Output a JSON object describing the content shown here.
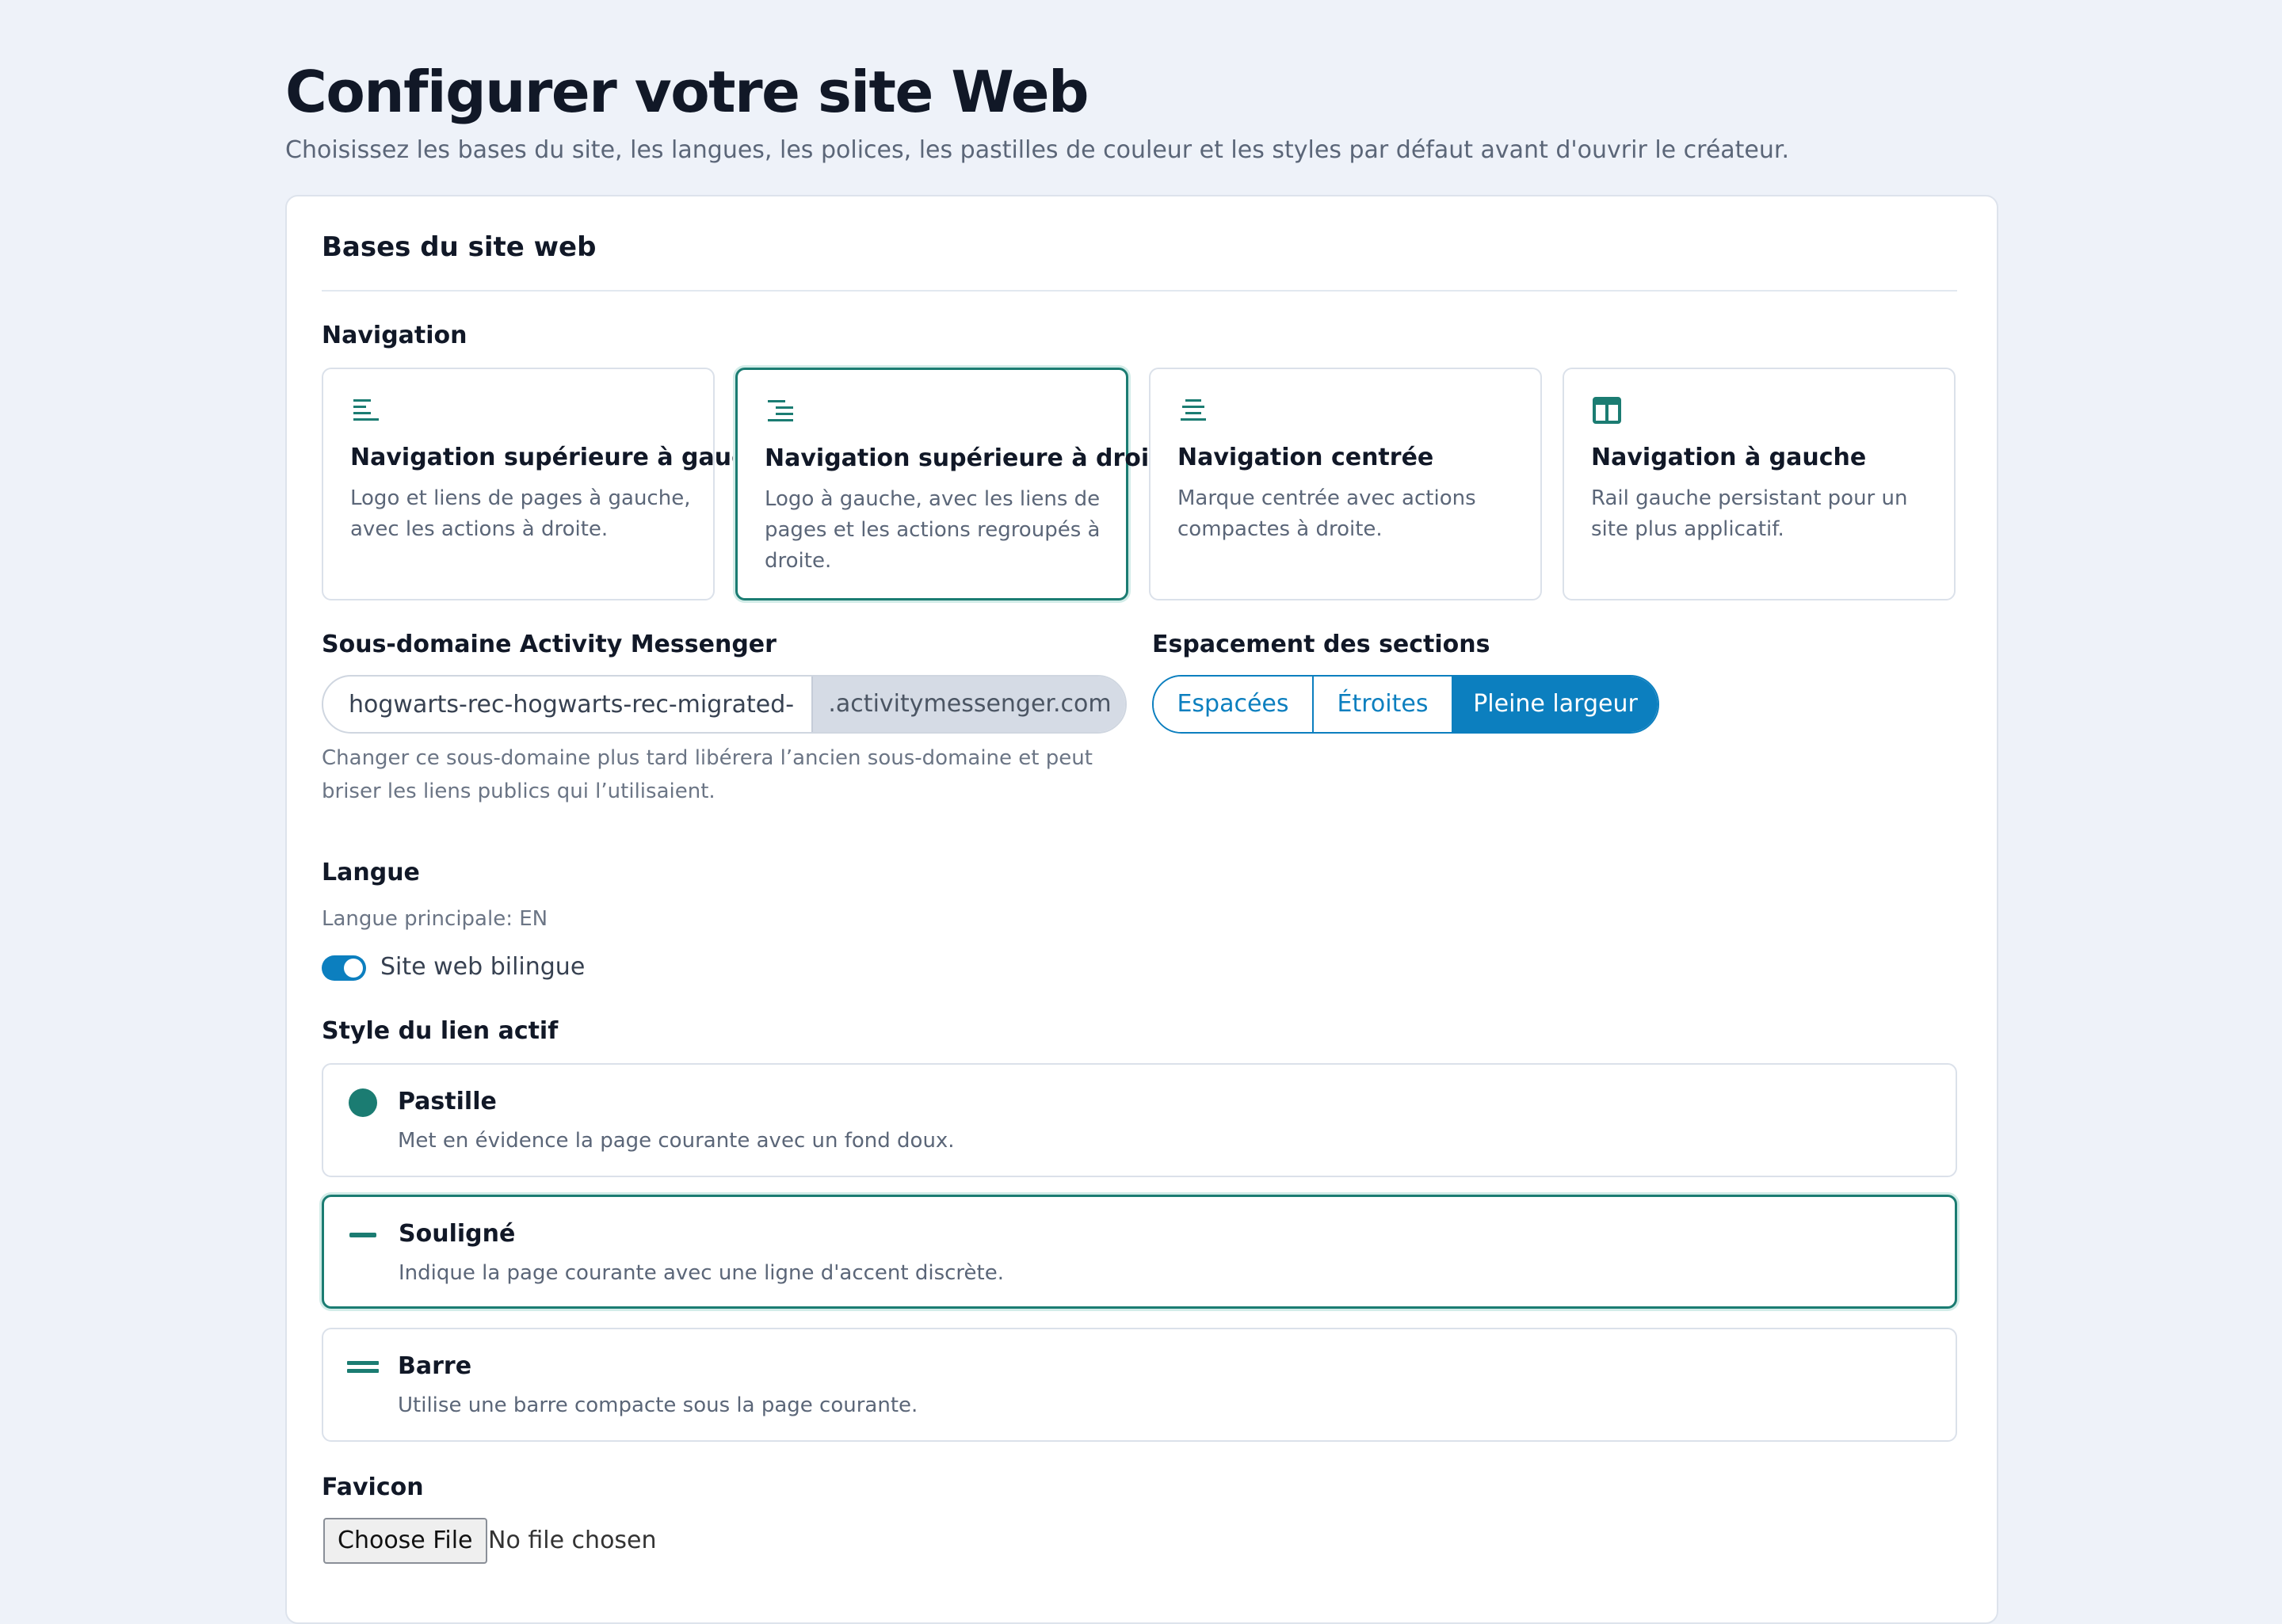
{
  "header": {
    "title": "Configurer votre site Web",
    "subtitle": "Choisissez les bases du site, les langues, les polices, les pastilles de couleur et les styles par défaut avant d'ouvrir le créateur."
  },
  "section": {
    "title": "Bases du site web"
  },
  "navigation": {
    "label": "Navigation",
    "options": [
      {
        "title": "Navigation supérieure à gauche",
        "description": "Logo et liens de pages à gauche, avec les actions à droite.",
        "icon": "align-left-icon",
        "selected": false
      },
      {
        "title": "Navigation supérieure à droite",
        "description": "Logo à gauche, avec les liens de pages et les actions regroupés à droite.",
        "icon": "align-right-icon",
        "selected": true
      },
      {
        "title": "Navigation centrée",
        "description": "Marque centrée avec actions compactes à droite.",
        "icon": "align-center-icon",
        "selected": false
      },
      {
        "title": "Navigation à gauche",
        "description": "Rail gauche persistant pour un site plus applicatif.",
        "icon": "sidebar-layout-icon",
        "selected": false
      }
    ]
  },
  "subdomain": {
    "label": "Sous-domaine Activity Messenger",
    "value": "hogwarts-rec-hogwarts-rec-migrated-",
    "suffix": ".activitymessenger.com",
    "help": "Changer ce sous-domaine plus tard libérera l’ancien sous-domaine et peut briser les liens publics qui l’utilisaient."
  },
  "spacing": {
    "label": "Espacement des sections",
    "options": [
      "Espacées",
      "Étroites",
      "Pleine largeur"
    ],
    "selected": "Pleine largeur"
  },
  "language": {
    "label": "Langue",
    "primary": "Langue principale: EN",
    "bilingual_label": "Site web bilingue",
    "bilingual_on": true
  },
  "active_link_style": {
    "label": "Style du lien actif",
    "options": [
      {
        "title": "Pastille",
        "description": "Met en évidence la page courante avec un fond doux.",
        "icon": "filled-circle-icon",
        "selected": false
      },
      {
        "title": "Souligné",
        "description": "Indique la page courante avec une ligne d'accent discrète.",
        "icon": "underline-dash-icon",
        "selected": true
      },
      {
        "title": "Barre",
        "description": "Utilise une barre compacte sous la page courante.",
        "icon": "double-bar-icon",
        "selected": false
      }
    ]
  },
  "favicon": {
    "label": "Favicon",
    "button": "Choose File",
    "status": "No file chosen"
  },
  "colors": {
    "accent": "#1b7c72",
    "primary_blue": "#0c7fbf",
    "background": "#eef2f9"
  }
}
